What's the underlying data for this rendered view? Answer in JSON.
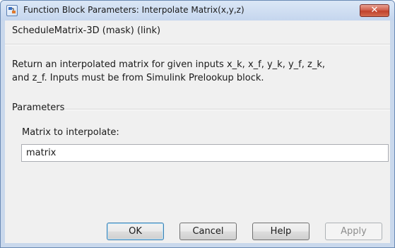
{
  "window": {
    "title": "Function Block Parameters: Interpolate Matrix(x,y,z)",
    "close_glyph": "✕",
    "icon": "simulink-block-icon"
  },
  "block": {
    "name": "ScheduleMatrix-3D (mask) (link)",
    "description_lines": [
      "Return an interpolated matrix for given inputs x_k, x_f, y_k, y_f, z_k,",
      "and z_f. Inputs must be from Simulink Prelookup block."
    ]
  },
  "parameters": {
    "section_label": "Parameters",
    "matrix_label": "Matrix to interpolate:",
    "matrix_value": "matrix"
  },
  "buttons": {
    "ok": "OK",
    "cancel": "Cancel",
    "help": "Help",
    "apply": "Apply"
  },
  "colors": {
    "title_bar": "#c5d6ee",
    "close_button": "#c0412c",
    "dialog_background": "#f0f0f0",
    "default_button_border": "#3c7fb1"
  }
}
